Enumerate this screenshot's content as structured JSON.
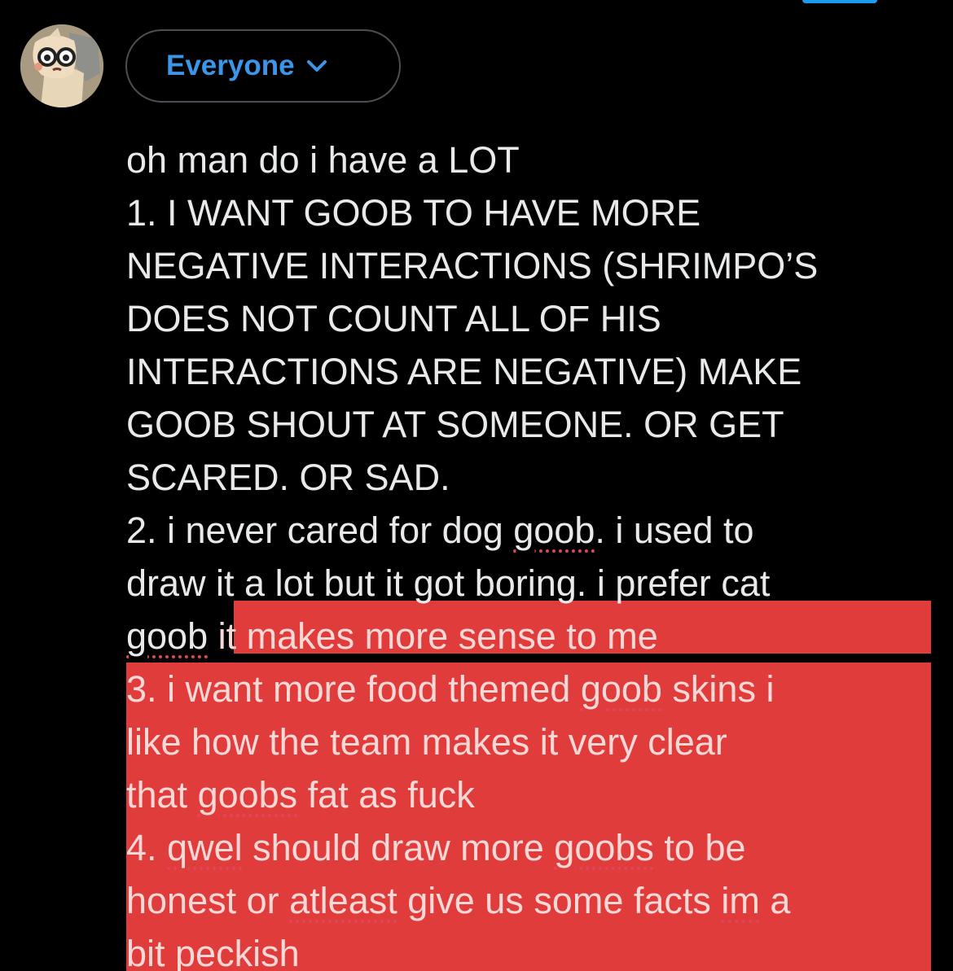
{
  "audience": {
    "label": "Everyone",
    "icon": "chevron-down-icon",
    "color": "#3d95e8"
  },
  "avatar": {
    "icon": "avatar-glasses-character"
  },
  "compose": {
    "lines": [
      "oh man do i have a LOT",
      "1. I WANT GOOB TO HAVE MORE",
      "NEGATIVE INTERACTIONS (SHRIMPO’S",
      "DOES NOT COUNT ALL OF HIS",
      "INTERACTIONS ARE NEGATIVE) MAKE",
      "GOOB SHOUT AT SOMEONE. OR GET",
      "SCARED. OR SAD.",
      "2. i never cared for dog ",
      "goob",
      ". i used to",
      "draw it a lot but it got boring. i prefer cat",
      "goob",
      " it makes more sense to me",
      "3. i want more food themed ",
      "goob",
      " skins i",
      "like how the team makes it very clear",
      "that ",
      "goobs",
      " fat as fuck",
      "4. ",
      "qwel",
      " should draw more ",
      "goobs",
      " to be",
      "honest or ",
      "atleast",
      " give us some facts ",
      "im",
      " a",
      "bit peckish"
    ],
    "selection_color": "#e03c3b",
    "text_color": "#e7e9ea"
  }
}
